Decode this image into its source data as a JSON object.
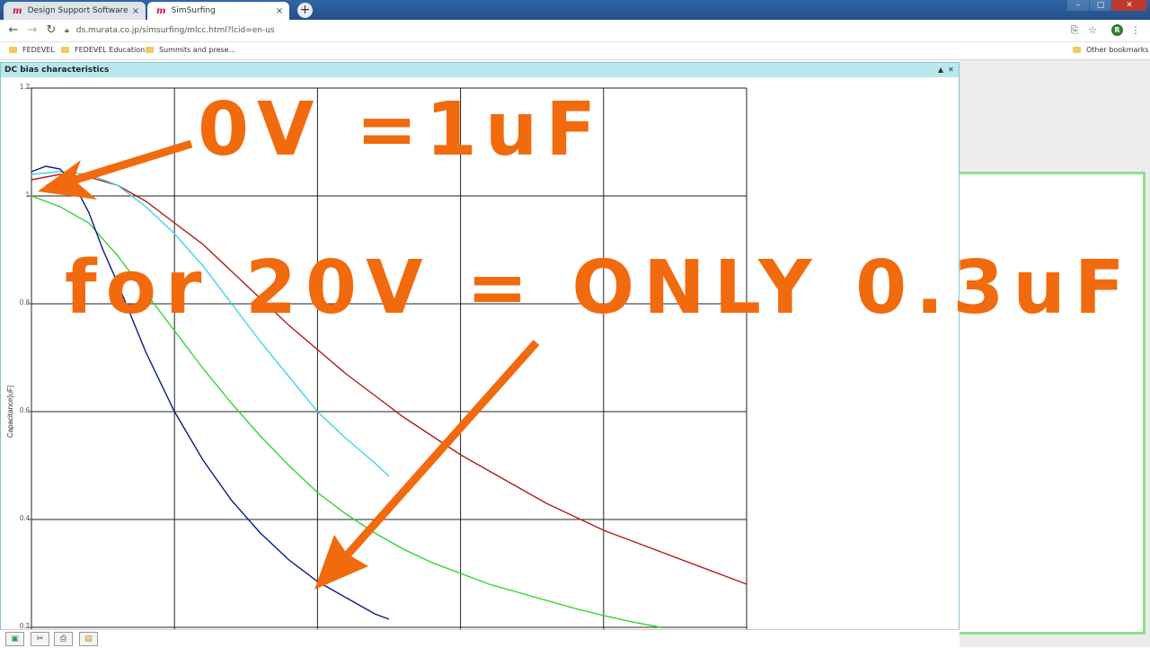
{
  "tabs": [
    {
      "favicon": "m",
      "label": "Design Support Software SimSurf",
      "close": "×"
    },
    {
      "favicon": "m",
      "label": "SimSurfing",
      "close": "×"
    }
  ],
  "new_tab": "+",
  "address": {
    "url": "ds.murata.co.jp/simsurfing/mlcc.html?lcid=en-us"
  },
  "avatar_letter": "R",
  "bookmarks": [
    "FEDEVEL",
    "FEDEVEL Education",
    "Summits and prese..."
  ],
  "other_bookmarks": "Other bookmarks",
  "panel": {
    "title": "DC bias characteristics",
    "collapse": "▲",
    "close": "✕"
  },
  "annotations": {
    "line1": "0V =1uF",
    "line2": "for 20V = ONLY 0.3uF"
  },
  "colors": {
    "annotation": "#f26a0e",
    "series_red": "#b01a1a",
    "series_cyan": "#3fd6e6",
    "series_green": "#2fd62f",
    "series_navy": "#0a1a8a"
  },
  "chart_data": {
    "type": "line",
    "title": "DC bias characteristics",
    "xlabel": "",
    "ylabel": "Capacitance[uF]",
    "ylim": [
      0.2,
      1.2
    ],
    "xlim": [
      0,
      50
    ],
    "yticks": [
      "1.2",
      "1",
      "0.8",
      "0.6",
      "0.4",
      "0.2"
    ],
    "ytick_values": [
      1.2,
      1.0,
      0.8,
      0.6,
      0.4,
      0.2
    ],
    "grid": true,
    "series": [
      {
        "color": "#b01a1a",
        "x": [
          0,
          2,
          4,
          6,
          8,
          10,
          12,
          14,
          16,
          18,
          20,
          22,
          24,
          26,
          28,
          30,
          32,
          34,
          36,
          38,
          40,
          42,
          44,
          46,
          48,
          50
        ],
        "y": [
          1.03,
          1.04,
          1.035,
          1.02,
          0.99,
          0.95,
          0.91,
          0.86,
          0.81,
          0.76,
          0.715,
          0.67,
          0.63,
          0.59,
          0.555,
          0.52,
          0.49,
          0.46,
          0.43,
          0.405,
          0.38,
          0.36,
          0.34,
          0.32,
          0.3,
          0.28
        ]
      },
      {
        "color": "#3fd6e6",
        "x": [
          0,
          2,
          4,
          6,
          8,
          10,
          12,
          14,
          16,
          18,
          20,
          22,
          24,
          25
        ],
        "y": [
          1.04,
          1.045,
          1.04,
          1.02,
          0.98,
          0.93,
          0.87,
          0.8,
          0.73,
          0.665,
          0.6,
          0.55,
          0.505,
          0.48
        ]
      },
      {
        "color": "#2fd62f",
        "x": [
          0,
          2,
          4,
          6,
          8,
          10,
          12,
          14,
          16,
          18,
          20,
          22,
          24,
          26,
          28,
          30,
          32,
          34,
          36,
          38,
          40,
          42,
          44
        ],
        "y": [
          1.0,
          0.98,
          0.95,
          0.89,
          0.82,
          0.75,
          0.68,
          0.615,
          0.555,
          0.5,
          0.45,
          0.41,
          0.375,
          0.345,
          0.32,
          0.3,
          0.28,
          0.265,
          0.25,
          0.235,
          0.222,
          0.21,
          0.2
        ]
      },
      {
        "color": "#0a1a8a",
        "x": [
          0,
          1,
          2,
          3,
          4,
          5,
          6,
          8,
          10,
          12,
          14,
          16,
          18,
          20,
          22,
          24,
          25
        ],
        "y": [
          1.045,
          1.055,
          1.05,
          1.02,
          0.97,
          0.9,
          0.84,
          0.71,
          0.6,
          0.51,
          0.435,
          0.375,
          0.325,
          0.285,
          0.255,
          0.225,
          0.215
        ]
      }
    ]
  },
  "bottom_buttons": [
    {
      "icon": "report-icon",
      "glyph": "▣"
    },
    {
      "icon": "settings-icon",
      "glyph": "✂"
    },
    {
      "icon": "print-icon",
      "glyph": "⎙"
    },
    {
      "icon": "export-icon",
      "glyph": "▤"
    }
  ]
}
